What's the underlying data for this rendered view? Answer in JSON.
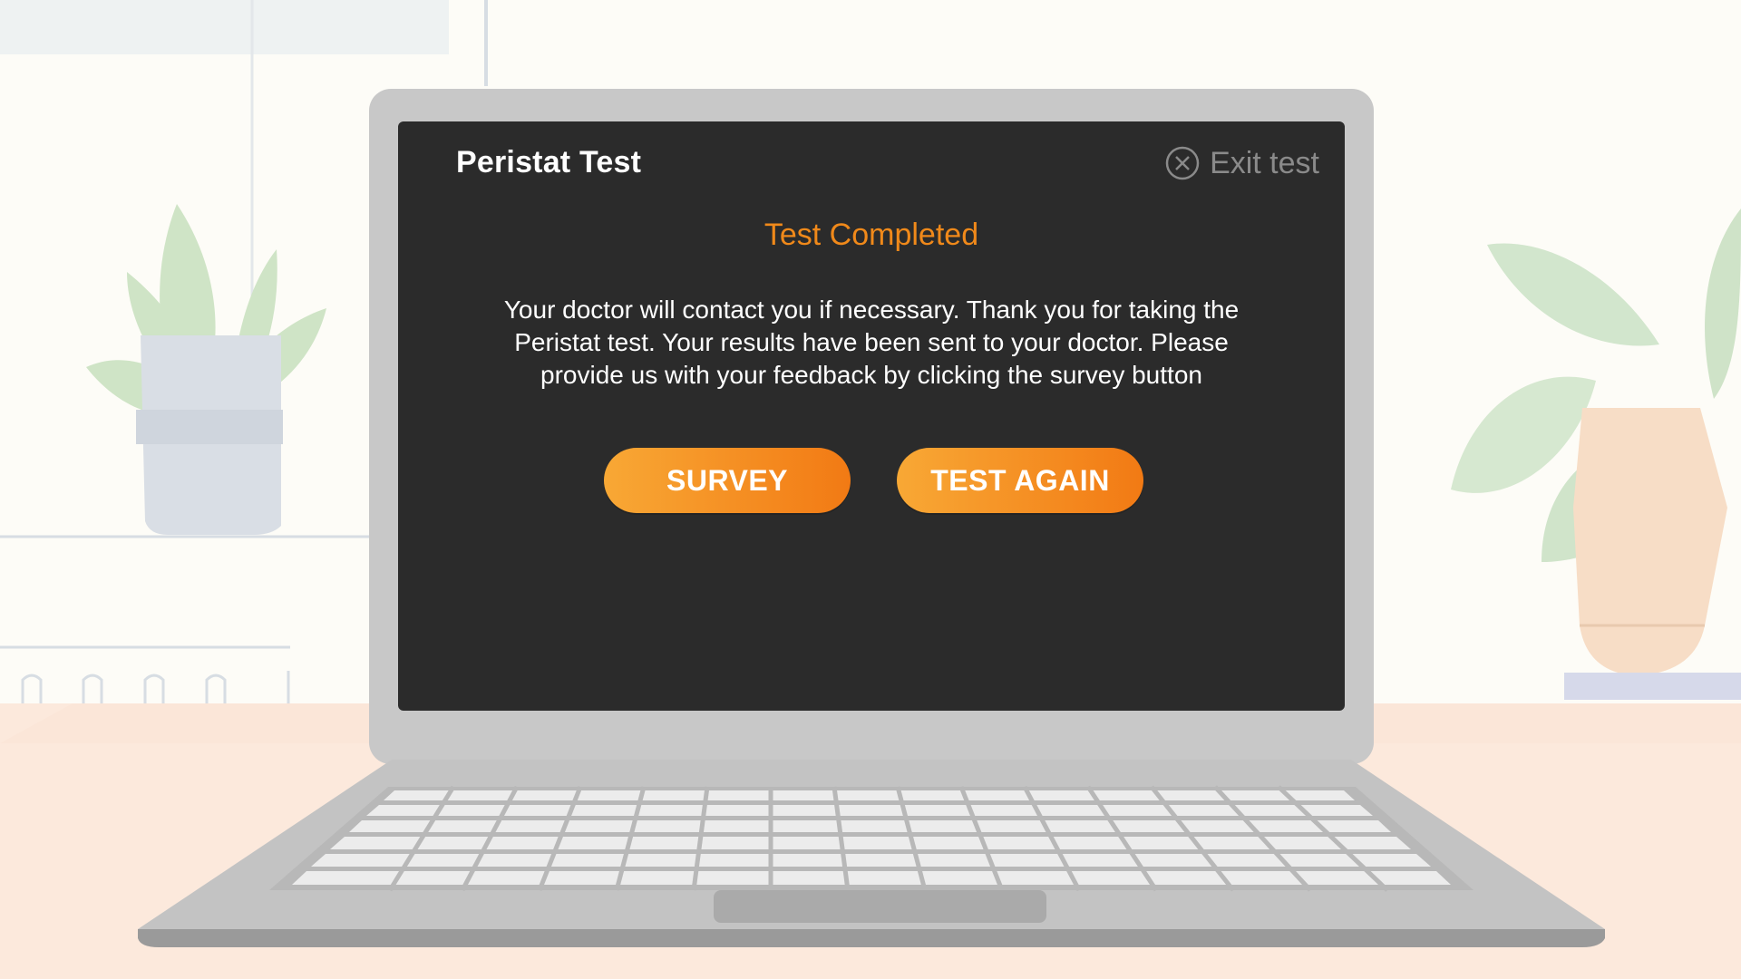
{
  "app": {
    "title": "Peristat Test",
    "exit_label": "Exit test"
  },
  "result": {
    "heading": "Test Completed",
    "message": "Your doctor will contact you if necessary. Thank you for taking the Peristat test. Your results have been sent to your doctor. Please provide us with your feedback by clicking the survey button"
  },
  "actions": {
    "survey_label": "SURVEY",
    "test_again_label": "TEST AGAIN"
  },
  "icons": {
    "exit": "close-circle-icon"
  },
  "colors": {
    "accent": "#f0891a",
    "screen_bg": "#2b2b2b",
    "button_gradient_start": "#f8a835",
    "button_gradient_end": "#f27a14",
    "laptop_body": "#c8c8c8",
    "desk": "#fce9dc"
  }
}
